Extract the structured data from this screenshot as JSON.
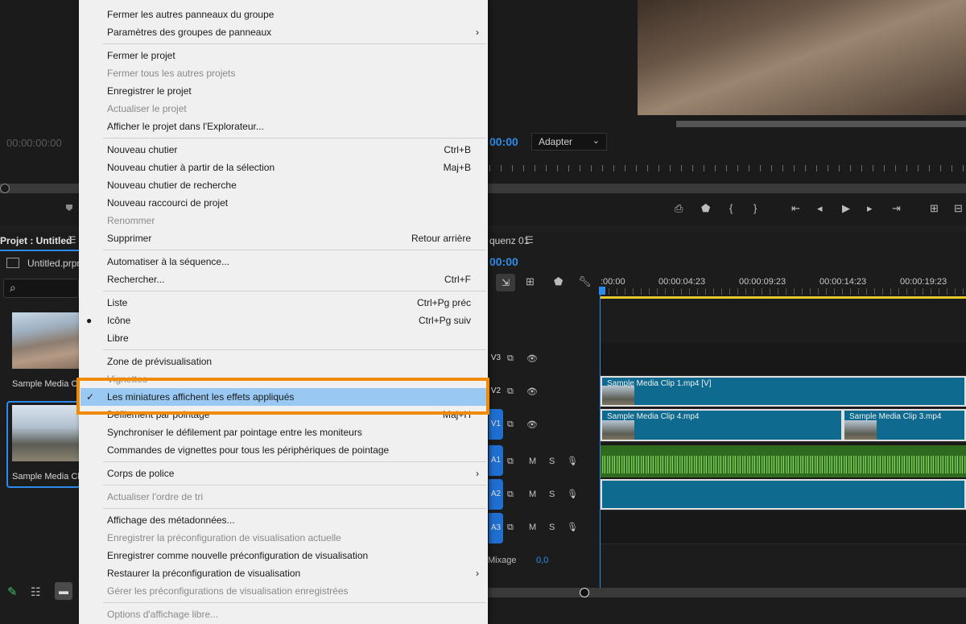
{
  "source_monitor": {
    "timecode": "00:00:00:00"
  },
  "program_monitor": {
    "timecode": "00:00",
    "fit_label": "Adapter"
  },
  "project_panel": {
    "title": "Projet : Untitled",
    "file_name": "Untitled.prproj",
    "items": [
      {
        "label": "Sample Media Clip"
      },
      {
        "label": "Sample Media Clip"
      }
    ]
  },
  "timeline": {
    "title": "quenz 01",
    "timecode": "00:00",
    "ruler_labels": [
      ":00:00",
      "00:00:04:23",
      "00:00:09:23",
      "00:00:14:23",
      "00:00:19:23"
    ],
    "tracks": [
      "V3",
      "V2",
      "V1",
      "A1",
      "A2",
      "A3"
    ],
    "clips": {
      "v2": "Sample Media Clip 1.mp4 [V]",
      "v1_a": "Sample Media Clip 4.mp4",
      "v1_b": "Sample Media Clip 3.mp4"
    },
    "mix_label": "Mixage",
    "mix_value": "0,0",
    "track_m": "M",
    "track_s": "S"
  },
  "menu": {
    "items": [
      {
        "label": "Fermer les autres panneaux du groupe"
      },
      {
        "label": "Paramètres des groupes de panneaux",
        "arrow": "›"
      },
      {
        "label": "Fermer le projet"
      },
      {
        "label": "Fermer tous les autres projets",
        "disabled": true
      },
      {
        "label": "Enregistrer le projet"
      },
      {
        "label": "Actualiser le projet",
        "disabled": true
      },
      {
        "label": "Afficher le projet dans l'Explorateur..."
      },
      {
        "label": "Nouveau chutier",
        "shortcut": "Ctrl+B"
      },
      {
        "label": "Nouveau chutier à partir de la sélection",
        "shortcut": "Maj+B"
      },
      {
        "label": "Nouveau chutier de recherche"
      },
      {
        "label": "Nouveau raccourci de projet"
      },
      {
        "label": "Renommer",
        "disabled": true
      },
      {
        "label": "Supprimer",
        "shortcut": "Retour arrière"
      },
      {
        "label": "Automatiser à la séquence..."
      },
      {
        "label": "Rechercher...",
        "shortcut": "Ctrl+F"
      },
      {
        "label": "Liste",
        "shortcut": "Ctrl+Pg préc"
      },
      {
        "label": "Icône",
        "shortcut": "Ctrl+Pg suiv",
        "mark": "●"
      },
      {
        "label": "Libre"
      },
      {
        "label": "Zone de prévisualisation"
      },
      {
        "label": "Vignettes",
        "disabled": true
      },
      {
        "label": "Les miniatures affichent les effets appliqués",
        "mark": "✓",
        "highlighted": true
      },
      {
        "label": "Défilement par pointage",
        "shortcut": "Maj+H"
      },
      {
        "label": "Synchroniser le défilement par pointage entre les moniteurs"
      },
      {
        "label": "Commandes de vignettes pour tous les périphériques de pointage"
      },
      {
        "label": "Corps de police",
        "arrow": "›"
      },
      {
        "label": "Actualiser l'ordre de tri",
        "disabled": true
      },
      {
        "label": "Affichage des métadonnées..."
      },
      {
        "label": "Enregistrer la préconfiguration de visualisation actuelle",
        "disabled": true
      },
      {
        "label": "Enregistrer comme nouvelle préconfiguration de visualisation"
      },
      {
        "label": "Restaurer la préconfiguration de visualisation",
        "arrow": "›"
      },
      {
        "label": "Gérer les préconfigurations de visualisation enregistrées",
        "disabled": true
      },
      {
        "label": "Options d'affichage libre...",
        "disabled": true
      }
    ]
  },
  "colors": {
    "accent": "#2d8ceb",
    "highlight_frame": "#f18a00",
    "menu_highlight": "#99c9f3"
  }
}
